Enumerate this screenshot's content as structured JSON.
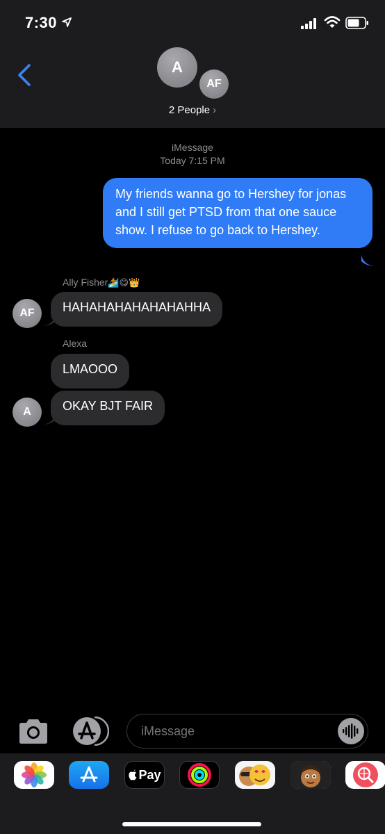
{
  "status_bar": {
    "time": "7:30"
  },
  "header": {
    "avatar_initials": [
      "A",
      "AF"
    ],
    "group_label": "2 People",
    "group_chevron": "›"
  },
  "conversation": {
    "service": "iMessage",
    "timestamp": "Today 7:15 PM",
    "sent_message": "My friends wanna go to Hershey for jonas and I still get PTSD from that one sauce show. I refuse to go back to Hershey.",
    "groups": [
      {
        "sender": "Ally Fisher",
        "sender_emoji": "🏄😋👑",
        "avatar": "AF",
        "messages": [
          "HAHAHAHAHAHAHAHHA"
        ]
      },
      {
        "sender": "Alexa",
        "avatar": "A",
        "messages": [
          "LMAOOO",
          "OKAY BJT FAIR"
        ]
      }
    ]
  },
  "input_bar": {
    "placeholder": "iMessage",
    "icons": [
      "camera-icon",
      "app-store-icon",
      "audio-waveform-icon"
    ]
  },
  "app_drawer": {
    "apps": [
      "photos",
      "app-store",
      "Pay",
      "activity",
      "memoji-stickers",
      "animoji",
      "search-images"
    ]
  },
  "colors": {
    "sent_bubble": "#2f7cf6",
    "received_bubble": "#2c2c2e",
    "header_bg": "#1c1c1e",
    "accent": "#3b82f6"
  }
}
